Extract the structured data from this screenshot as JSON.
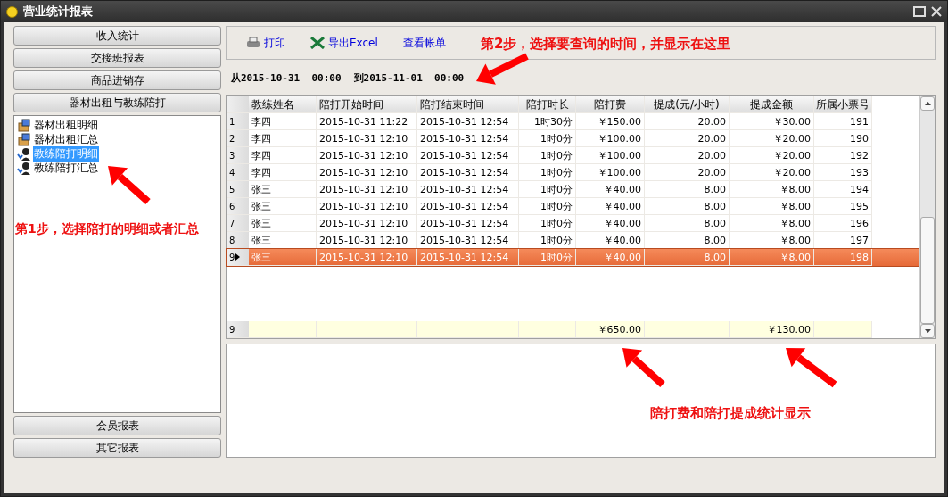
{
  "window": {
    "title": "营业统计报表"
  },
  "sidebar": {
    "top_buttons": [
      "收入统计",
      "交接班报表",
      "商品进销存",
      "器材出租与教练陪打"
    ],
    "tree": [
      {
        "label": "器材出租明细",
        "kind": "equipment",
        "selected": false
      },
      {
        "label": "器材出租汇总",
        "kind": "equipment",
        "selected": false
      },
      {
        "label": "教练陪打明细",
        "kind": "coach",
        "selected": true
      },
      {
        "label": "教练陪打汇总",
        "kind": "coach",
        "selected": false
      }
    ],
    "bottom_buttons": [
      "会员报表",
      "其它报表"
    ]
  },
  "toolbar": [
    {
      "label": "打印",
      "kind": "print"
    },
    {
      "label": "导出Excel",
      "kind": "excel"
    },
    {
      "label": "查看帐单",
      "kind": "plain"
    }
  ],
  "date_range": {
    "from": "从2015-10-31  00:00",
    "to": "到2015-11-01  00:00"
  },
  "table": {
    "columns": [
      "教练姓名",
      "陪打开始时间",
      "陪打结束时间",
      "陪打时长",
      "陪打费",
      "提成(元/小时)",
      "提成金额",
      "所属小票号"
    ],
    "rows": [
      {
        "index": "1",
        "selected": false,
        "cells": [
          "李四",
          "2015-10-31 11:22",
          "2015-10-31 12:54",
          "1时30分",
          "￥150.00",
          "20.00",
          "￥30.00",
          "191"
        ]
      },
      {
        "index": "2",
        "selected": false,
        "cells": [
          "李四",
          "2015-10-31 12:10",
          "2015-10-31 12:54",
          "1时0分",
          "￥100.00",
          "20.00",
          "￥20.00",
          "190"
        ]
      },
      {
        "index": "3",
        "selected": false,
        "cells": [
          "李四",
          "2015-10-31 12:10",
          "2015-10-31 12:54",
          "1时0分",
          "￥100.00",
          "20.00",
          "￥20.00",
          "192"
        ]
      },
      {
        "index": "4",
        "selected": false,
        "cells": [
          "李四",
          "2015-10-31 12:10",
          "2015-10-31 12:54",
          "1时0分",
          "￥100.00",
          "20.00",
          "￥20.00",
          "193"
        ]
      },
      {
        "index": "5",
        "selected": false,
        "cells": [
          "张三",
          "2015-10-31 12:10",
          "2015-10-31 12:54",
          "1时0分",
          "￥40.00",
          "8.00",
          "￥8.00",
          "194"
        ]
      },
      {
        "index": "6",
        "selected": false,
        "cells": [
          "张三",
          "2015-10-31 12:10",
          "2015-10-31 12:54",
          "1时0分",
          "￥40.00",
          "8.00",
          "￥8.00",
          "195"
        ]
      },
      {
        "index": "7",
        "selected": false,
        "cells": [
          "张三",
          "2015-10-31 12:10",
          "2015-10-31 12:54",
          "1时0分",
          "￥40.00",
          "8.00",
          "￥8.00",
          "196"
        ]
      },
      {
        "index": "8",
        "selected": false,
        "cells": [
          "张三",
          "2015-10-31 12:10",
          "2015-10-31 12:54",
          "1时0分",
          "￥40.00",
          "8.00",
          "￥8.00",
          "197"
        ]
      },
      {
        "index": "9",
        "selected": true,
        "cells": [
          "张三",
          "2015-10-31 12:10",
          "2015-10-31 12:54",
          "1时0分",
          "￥40.00",
          "8.00",
          "￥8.00",
          "198"
        ]
      }
    ],
    "footer": {
      "index": "9",
      "cells": [
        "",
        "",
        "",
        "",
        "￥650.00",
        "",
        "￥130.00",
        ""
      ]
    }
  },
  "annotations": {
    "step1": "第1步，选择陪打的明细或者汇总",
    "step2": "第2步，选择要查询的时间，并显示在这里",
    "totals": "陪打费和陪打提成统计显示"
  }
}
